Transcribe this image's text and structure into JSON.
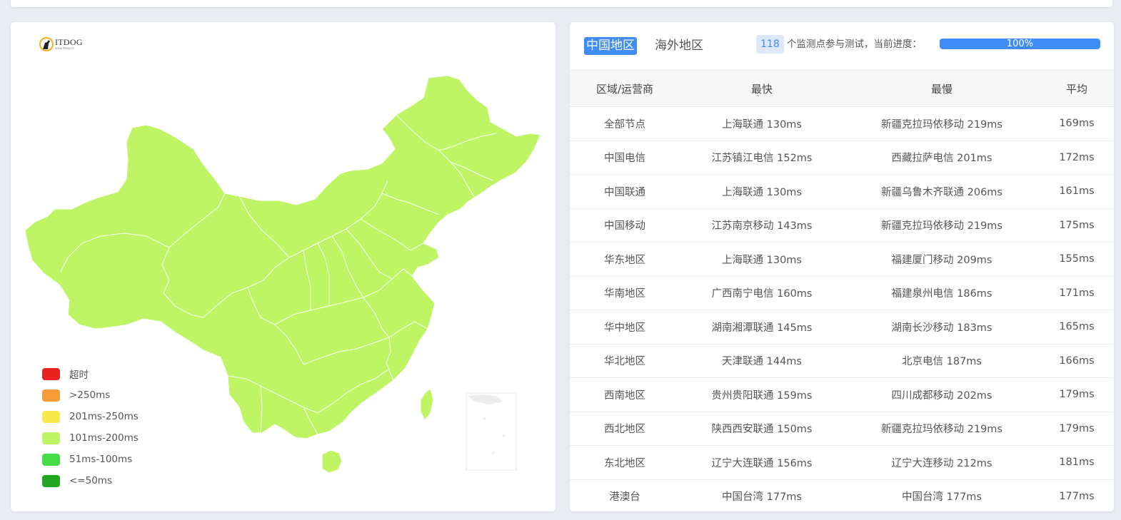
{
  "logo": {
    "name": "ITDOG",
    "url": "www.itdog.cn"
  },
  "legend": [
    {
      "label": "超时",
      "color": "#e8221f"
    },
    {
      "label": ">250ms",
      "color": "#fb9a38"
    },
    {
      "label": "201ms-250ms",
      "color": "#f7e94d"
    },
    {
      "label": "101ms-200ms",
      "color": "#bff565"
    },
    {
      "label": "51ms-100ms",
      "color": "#44dd47"
    },
    {
      "label": "<=50ms",
      "color": "#21a722"
    }
  ],
  "map": {
    "fill_color": "#bff565"
  },
  "tabs": {
    "china": "中国地区",
    "overseas": "海外地区"
  },
  "progress": {
    "count": "118",
    "text": "个监测点参与测试，当前进度：",
    "percent_label": "100%",
    "fraction": 1.0
  },
  "table": {
    "headers": [
      "区域/运营商",
      "最快",
      "最慢",
      "平均"
    ],
    "rows": [
      [
        "全部节点",
        "上海联通 130ms",
        "新疆克拉玛依移动 219ms",
        "169ms"
      ],
      [
        "中国电信",
        "江苏镇江电信 152ms",
        "西藏拉萨电信 201ms",
        "172ms"
      ],
      [
        "中国联通",
        "上海联通 130ms",
        "新疆乌鲁木齐联通 206ms",
        "161ms"
      ],
      [
        "中国移动",
        "江苏南京移动 143ms",
        "新疆克拉玛依移动 219ms",
        "175ms"
      ],
      [
        "华东地区",
        "上海联通 130ms",
        "福建厦门移动 209ms",
        "155ms"
      ],
      [
        "华南地区",
        "广西南宁电信 160ms",
        "福建泉州电信 186ms",
        "171ms"
      ],
      [
        "华中地区",
        "湖南湘潭联通 145ms",
        "湖南长沙移动 183ms",
        "165ms"
      ],
      [
        "华北地区",
        "天津联通 144ms",
        "北京电信 187ms",
        "166ms"
      ],
      [
        "西南地区",
        "贵州贵阳联通 159ms",
        "四川成都移动 202ms",
        "179ms"
      ],
      [
        "西北地区",
        "陕西西安联通 150ms",
        "新疆克拉玛依移动 219ms",
        "179ms"
      ],
      [
        "东北地区",
        "辽宁大连联通 156ms",
        "辽宁大连移动 212ms",
        "181ms"
      ],
      [
        "港澳台",
        "中国台湾 177ms",
        "中国台湾 177ms",
        "177ms"
      ]
    ]
  }
}
